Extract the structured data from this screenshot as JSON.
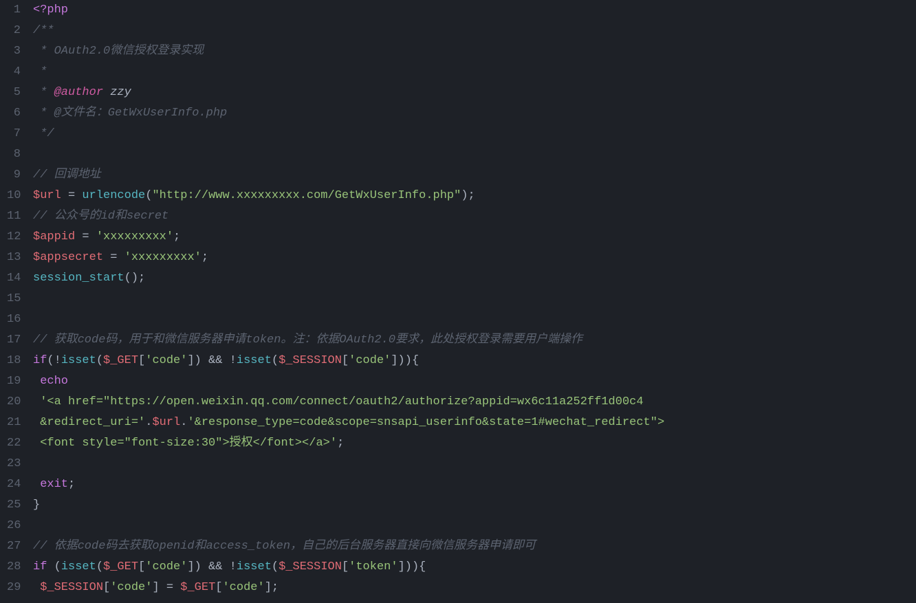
{
  "lines": [
    {
      "n": "1",
      "tokens": [
        {
          "t": "<?php",
          "c": "c-tag"
        }
      ]
    },
    {
      "n": "2",
      "tokens": [
        {
          "t": "/**",
          "c": "c-comment"
        }
      ]
    },
    {
      "n": "3",
      "tokens": [
        {
          "t": " * OAuth2.0微信授权登录实现",
          "c": "c-comment"
        }
      ]
    },
    {
      "n": "4",
      "tokens": [
        {
          "t": " *",
          "c": "c-comment"
        }
      ]
    },
    {
      "n": "5",
      "tokens": [
        {
          "t": " * ",
          "c": "c-comment"
        },
        {
          "t": "@author",
          "c": "c-doctag"
        },
        {
          "t": " zzy",
          "c": "c-docname"
        }
      ]
    },
    {
      "n": "6",
      "tokens": [
        {
          "t": " * @文件名：GetWxUserInfo.php",
          "c": "c-comment"
        }
      ]
    },
    {
      "n": "7",
      "tokens": [
        {
          "t": " */",
          "c": "c-comment"
        }
      ]
    },
    {
      "n": "8",
      "tokens": []
    },
    {
      "n": "9",
      "tokens": [
        {
          "t": "// 回调地址",
          "c": "c-comment"
        }
      ]
    },
    {
      "n": "10",
      "tokens": [
        {
          "t": "$url",
          "c": "c-var"
        },
        {
          "t": " = ",
          "c": "c-op"
        },
        {
          "t": "urlencode",
          "c": "c-func"
        },
        {
          "t": "(",
          "c": "c-punct"
        },
        {
          "t": "\"http://www.xxxxxxxxx.com/GetWxUserInfo.php\"",
          "c": "c-string"
        },
        {
          "t": ");",
          "c": "c-punct"
        }
      ]
    },
    {
      "n": "11",
      "tokens": [
        {
          "t": "// 公众号的id和secret",
          "c": "c-comment"
        }
      ]
    },
    {
      "n": "12",
      "tokens": [
        {
          "t": "$appid",
          "c": "c-var"
        },
        {
          "t": " = ",
          "c": "c-op"
        },
        {
          "t": "'xxxxxxxxx'",
          "c": "c-string"
        },
        {
          "t": ";",
          "c": "c-punct"
        }
      ]
    },
    {
      "n": "13",
      "tokens": [
        {
          "t": "$appsecret",
          "c": "c-var"
        },
        {
          "t": " = ",
          "c": "c-op"
        },
        {
          "t": "'xxxxxxxxx'",
          "c": "c-string"
        },
        {
          "t": ";",
          "c": "c-punct"
        }
      ]
    },
    {
      "n": "14",
      "tokens": [
        {
          "t": "session_start",
          "c": "c-func"
        },
        {
          "t": "();",
          "c": "c-punct"
        }
      ]
    },
    {
      "n": "15",
      "tokens": []
    },
    {
      "n": "16",
      "tokens": []
    },
    {
      "n": "17",
      "tokens": [
        {
          "t": "// 获取code码，用于和微信服务器申请token。注：依据OAuth2.0要求，此处授权登录需要用户端操作",
          "c": "c-comment"
        }
      ]
    },
    {
      "n": "18",
      "tokens": [
        {
          "t": "if",
          "c": "c-keyword"
        },
        {
          "t": "(!",
          "c": "c-punct"
        },
        {
          "t": "isset",
          "c": "c-func"
        },
        {
          "t": "(",
          "c": "c-punct"
        },
        {
          "t": "$_GET",
          "c": "c-var"
        },
        {
          "t": "[",
          "c": "c-punct"
        },
        {
          "t": "'code'",
          "c": "c-string"
        },
        {
          "t": "]) ",
          "c": "c-punct"
        },
        {
          "t": "&&",
          "c": "c-op"
        },
        {
          "t": " !",
          "c": "c-punct"
        },
        {
          "t": "isset",
          "c": "c-func"
        },
        {
          "t": "(",
          "c": "c-punct"
        },
        {
          "t": "$_SESSION",
          "c": "c-var"
        },
        {
          "t": "[",
          "c": "c-punct"
        },
        {
          "t": "'code'",
          "c": "c-string"
        },
        {
          "t": "])){",
          "c": "c-punct"
        }
      ]
    },
    {
      "n": "19",
      "tokens": [
        {
          "t": " ",
          "c": "c-plain"
        },
        {
          "t": "echo",
          "c": "c-keyword"
        }
      ]
    },
    {
      "n": "20",
      "tokens": [
        {
          "t": " ",
          "c": "c-plain"
        },
        {
          "t": "'<a href=\"https://open.weixin.qq.com/connect/oauth2/authorize?appid=wx6c11a252ff1d00c4",
          "c": "c-string"
        }
      ]
    },
    {
      "n": "21",
      "tokens": [
        {
          "t": " ",
          "c": "c-plain"
        },
        {
          "t": "&redirect_uri='",
          "c": "c-string"
        },
        {
          "t": ".",
          "c": "c-op"
        },
        {
          "t": "$url",
          "c": "c-var"
        },
        {
          "t": ".",
          "c": "c-op"
        },
        {
          "t": "'&response_type=code&scope=snsapi_userinfo&state=1#wechat_redirect\">",
          "c": "c-string"
        }
      ]
    },
    {
      "n": "22",
      "tokens": [
        {
          "t": " ",
          "c": "c-plain"
        },
        {
          "t": "<font style=\"font-size:30\">授权</font></a>'",
          "c": "c-string"
        },
        {
          "t": ";",
          "c": "c-punct"
        }
      ]
    },
    {
      "n": "23",
      "tokens": []
    },
    {
      "n": "24",
      "tokens": [
        {
          "t": " ",
          "c": "c-plain"
        },
        {
          "t": "exit",
          "c": "c-keyword"
        },
        {
          "t": ";",
          "c": "c-punct"
        }
      ]
    },
    {
      "n": "25",
      "tokens": [
        {
          "t": "}",
          "c": "c-punct"
        }
      ]
    },
    {
      "n": "26",
      "tokens": []
    },
    {
      "n": "27",
      "tokens": [
        {
          "t": "// 依据code码去获取openid和access_token，自己的后台服务器直接向微信服务器申请即可",
          "c": "c-comment"
        }
      ]
    },
    {
      "n": "28",
      "tokens": [
        {
          "t": "if",
          "c": "c-keyword"
        },
        {
          "t": " (",
          "c": "c-punct"
        },
        {
          "t": "isset",
          "c": "c-func"
        },
        {
          "t": "(",
          "c": "c-punct"
        },
        {
          "t": "$_GET",
          "c": "c-var"
        },
        {
          "t": "[",
          "c": "c-punct"
        },
        {
          "t": "'code'",
          "c": "c-string"
        },
        {
          "t": "]) ",
          "c": "c-punct"
        },
        {
          "t": "&&",
          "c": "c-op"
        },
        {
          "t": " !",
          "c": "c-punct"
        },
        {
          "t": "isset",
          "c": "c-func"
        },
        {
          "t": "(",
          "c": "c-punct"
        },
        {
          "t": "$_SESSION",
          "c": "c-var"
        },
        {
          "t": "[",
          "c": "c-punct"
        },
        {
          "t": "'token'",
          "c": "c-string"
        },
        {
          "t": "])){",
          "c": "c-punct"
        }
      ]
    },
    {
      "n": "29",
      "tokens": [
        {
          "t": " ",
          "c": "c-plain"
        },
        {
          "t": "$_SESSION",
          "c": "c-var"
        },
        {
          "t": "[",
          "c": "c-punct"
        },
        {
          "t": "'code'",
          "c": "c-string"
        },
        {
          "t": "] = ",
          "c": "c-punct"
        },
        {
          "t": "$_GET",
          "c": "c-var"
        },
        {
          "t": "[",
          "c": "c-punct"
        },
        {
          "t": "'code'",
          "c": "c-string"
        },
        {
          "t": "];",
          "c": "c-punct"
        }
      ]
    }
  ]
}
